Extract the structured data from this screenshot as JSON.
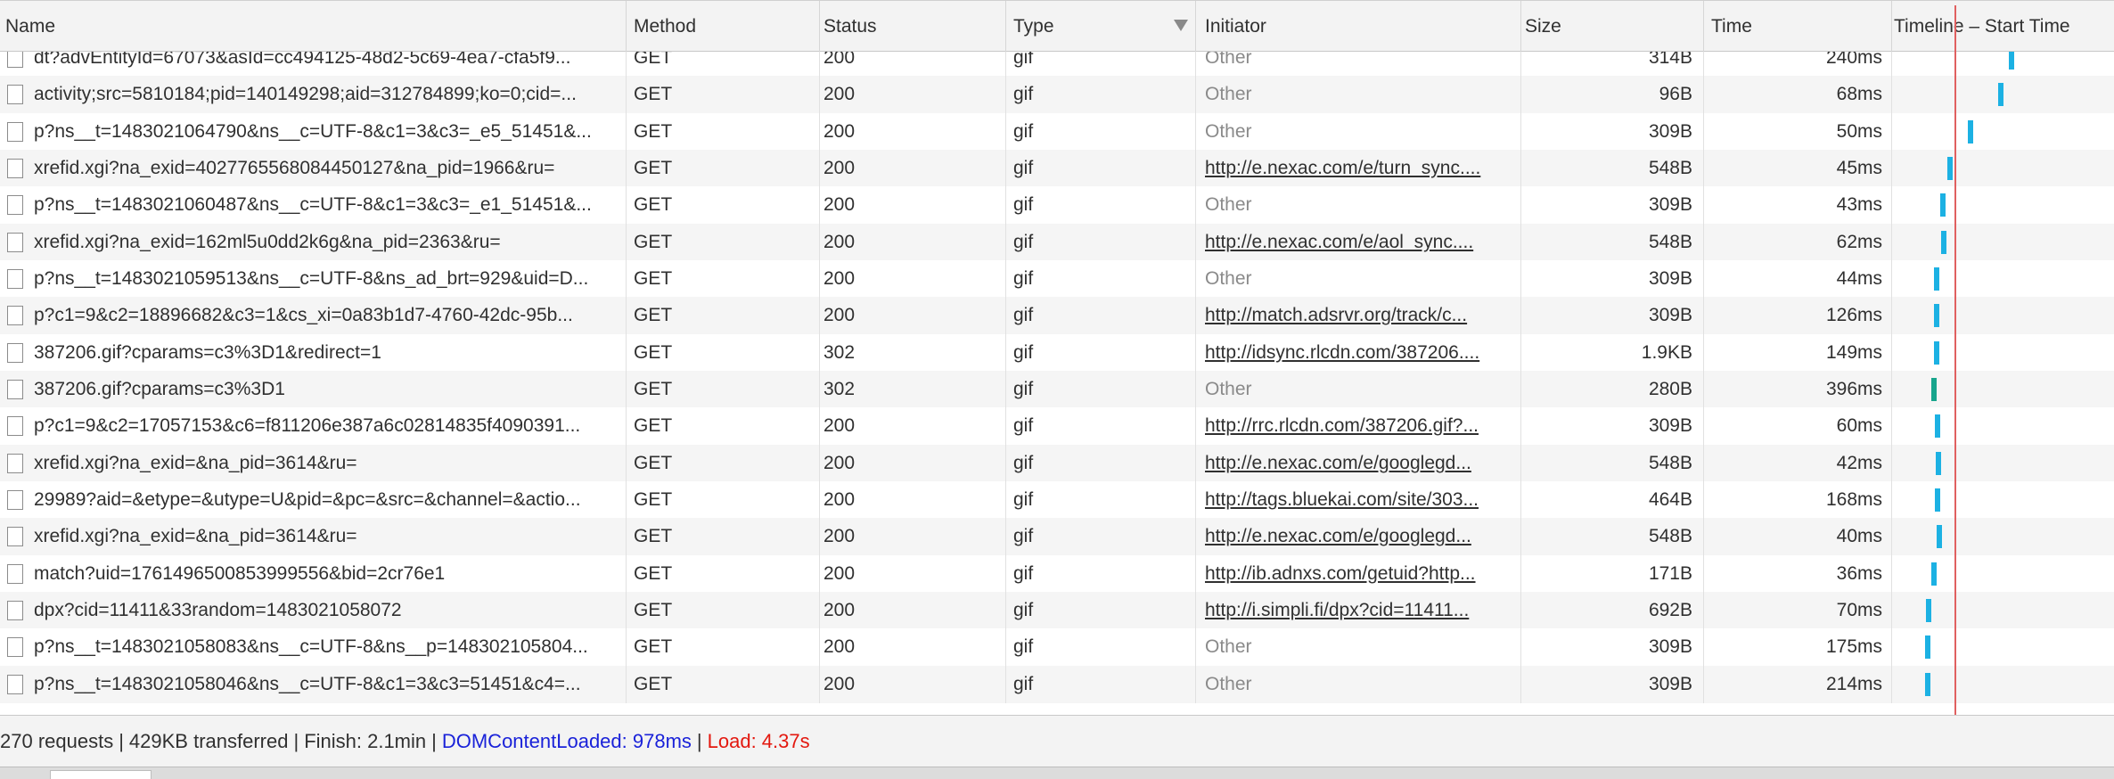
{
  "columns": {
    "name": "Name",
    "method": "Method",
    "status": "Status",
    "type": "Type",
    "initiator": "Initiator",
    "size": "Size",
    "time": "Time",
    "timeline": "Timeline – Start Time"
  },
  "sort_icon": "sort-descending-triangle-icon",
  "rows": [
    {
      "name": "dt?advEntityId=67073&asId=cc494125-48d2-5c69-4ea7-cfa5f9...",
      "method": "GET",
      "status": "200",
      "type": "gif",
      "initiator": "Other",
      "initiator_is_link": false,
      "size": "314B",
      "time": "240ms",
      "bar_start_fraction": 0.527,
      "bar_color": "#1cb1e3"
    },
    {
      "name": "activity;src=5810184;pid=140149298;aid=312784899;ko=0;cid=...",
      "method": "GET",
      "status": "200",
      "type": "gif",
      "initiator": "Other",
      "initiator_is_link": false,
      "size": "96B",
      "time": "68ms",
      "bar_start_fraction": 0.478,
      "bar_color": "#1cb1e3"
    },
    {
      "name": "p?ns__t=1483021064790&ns__c=UTF-8&c1=3&c3=_e5_51451&...",
      "method": "GET",
      "status": "200",
      "type": "gif",
      "initiator": "Other",
      "initiator_is_link": false,
      "size": "309B",
      "time": "50ms",
      "bar_start_fraction": 0.34,
      "bar_color": "#1cb1e3"
    },
    {
      "name": "xrefid.xgi?na_exid=4027765568084450127&na_pid=1966&ru=",
      "method": "GET",
      "status": "200",
      "type": "gif",
      "initiator": "http://e.nexac.com/e/turn_sync....",
      "initiator_is_link": true,
      "size": "548B",
      "time": "45ms",
      "bar_start_fraction": 0.249,
      "bar_color": "#1cb1e3"
    },
    {
      "name": "p?ns__t=1483021060487&ns__c=UTF-8&c1=3&c3=_e1_51451&...",
      "method": "GET",
      "status": "200",
      "type": "gif",
      "initiator": "Other",
      "initiator_is_link": false,
      "size": "309B",
      "time": "43ms",
      "bar_start_fraction": 0.217,
      "bar_color": "#1cb1e3"
    },
    {
      "name": "xrefid.xgi?na_exid=162ml5u0dd2k6g&na_pid=2363&ru=",
      "method": "GET",
      "status": "200",
      "type": "gif",
      "initiator": "http://e.nexac.com/e/aol_sync....",
      "initiator_is_link": true,
      "size": "548B",
      "time": "62ms",
      "bar_start_fraction": 0.221,
      "bar_color": "#1cb1e3"
    },
    {
      "name": "p?ns__t=1483021059513&ns__c=UTF-8&ns_ad_brt=929&uid=D...",
      "method": "GET",
      "status": "200",
      "type": "gif",
      "initiator": "Other",
      "initiator_is_link": false,
      "size": "309B",
      "time": "44ms",
      "bar_start_fraction": 0.189,
      "bar_color": "#1cb1e3"
    },
    {
      "name": "p?c1=9&c2=18896682&c3=1&cs_xi=0a83b1d7-4760-42dc-95b...",
      "method": "GET",
      "status": "200",
      "type": "gif",
      "initiator": "http://match.adsrvr.org/track/c...",
      "initiator_is_link": true,
      "size": "309B",
      "time": "126ms",
      "bar_start_fraction": 0.189,
      "bar_color": "#1cb1e3"
    },
    {
      "name": "387206.gif?cparams=c3%3D1&redirect=1",
      "method": "GET",
      "status": "302",
      "type": "gif",
      "initiator": "http://idsync.rlcdn.com/387206....",
      "initiator_is_link": true,
      "size": "1.9KB",
      "time": "149ms",
      "bar_start_fraction": 0.189,
      "bar_color": "#1cb1e3"
    },
    {
      "name": "387206.gif?cparams=c3%3D1",
      "method": "GET",
      "status": "302",
      "type": "gif",
      "initiator": "Other",
      "initiator_is_link": false,
      "size": "280B",
      "time": "396ms",
      "bar_start_fraction": 0.177,
      "bar_color": "#18a58d"
    },
    {
      "name": "p?c1=9&c2=17057153&c6=f811206e387a6c02814835f4090391...",
      "method": "GET",
      "status": "200",
      "type": "gif",
      "initiator": "http://rrc.rlcdn.com/387206.gif?...",
      "initiator_is_link": true,
      "size": "309B",
      "time": "60ms",
      "bar_start_fraction": 0.193,
      "bar_color": "#1cb1e3"
    },
    {
      "name": "xrefid.xgi?na_exid=&na_pid=3614&ru=",
      "method": "GET",
      "status": "200",
      "type": "gif",
      "initiator": "http://e.nexac.com/e/googlegd...",
      "initiator_is_link": true,
      "size": "548B",
      "time": "42ms",
      "bar_start_fraction": 0.197,
      "bar_color": "#1cb1e3"
    },
    {
      "name": "29989?aid=&etype=&utype=U&pid=&pc=&src=&channel=&actio...",
      "method": "GET",
      "status": "200",
      "type": "gif",
      "initiator": "http://tags.bluekai.com/site/303...",
      "initiator_is_link": true,
      "size": "464B",
      "time": "168ms",
      "bar_start_fraction": 0.193,
      "bar_color": "#1cb1e3"
    },
    {
      "name": "xrefid.xgi?na_exid=&na_pid=3614&ru=",
      "method": "GET",
      "status": "200",
      "type": "gif",
      "initiator": "http://e.nexac.com/e/googlegd...",
      "initiator_is_link": true,
      "size": "548B",
      "time": "40ms",
      "bar_start_fraction": 0.201,
      "bar_color": "#1cb1e3"
    },
    {
      "name": "match?uid=1761496500853999556&bid=2cr76e1",
      "method": "GET",
      "status": "200",
      "type": "gif",
      "initiator": "http://ib.adnxs.com/getuid?http...",
      "initiator_is_link": true,
      "size": "171B",
      "time": "36ms",
      "bar_start_fraction": 0.177,
      "bar_color": "#1cb1e3"
    },
    {
      "name": "dpx?cid=11411&33random=1483021058072",
      "method": "GET",
      "status": "200",
      "type": "gif",
      "initiator": "http://i.simpli.fi/dpx?cid=11411...",
      "initiator_is_link": true,
      "size": "692B",
      "time": "70ms",
      "bar_start_fraction": 0.153,
      "bar_color": "#1cb1e3"
    },
    {
      "name": "p?ns__t=1483021058083&ns__c=UTF-8&ns__p=148302105804...",
      "method": "GET",
      "status": "200",
      "type": "gif",
      "initiator": "Other",
      "initiator_is_link": false,
      "size": "309B",
      "time": "175ms",
      "bar_start_fraction": 0.149,
      "bar_color": "#1cb1e3"
    },
    {
      "name": "p?ns__t=1483021058046&ns__c=UTF-8&c1=3&c3=51451&c4=...",
      "method": "GET",
      "status": "200",
      "type": "gif",
      "initiator": "Other",
      "initiator_is_link": false,
      "size": "309B",
      "time": "214ms",
      "bar_start_fraction": 0.149,
      "bar_color": "#1cb1e3"
    }
  ],
  "statusbar": {
    "requests": "270 requests",
    "transferred": "429KB transferred",
    "finish": "Finish: 2.1min",
    "dom_content_loaded": "DOMContentLoaded: 978ms",
    "load": "Load: 4.37s",
    "separator": "|"
  },
  "colors": {
    "dom_content_loaded": "#1a22d9",
    "load": "#e3180f",
    "load_line": "#e06060",
    "bar": "#1cb1e3",
    "bar_wait": "#18a58d"
  }
}
